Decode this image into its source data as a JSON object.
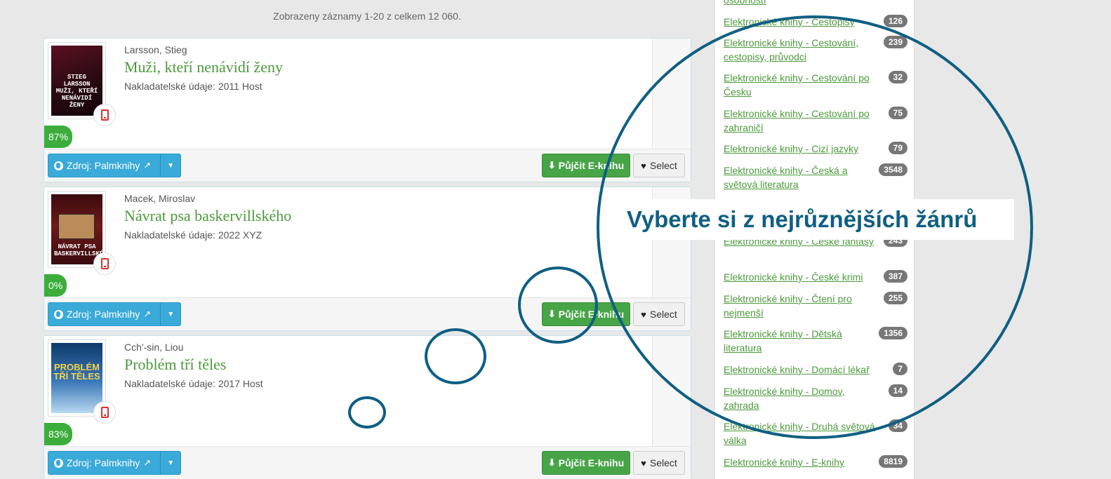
{
  "summary": "Zobrazeny záznamy 1-20 z celkem 12 060.",
  "records": [
    {
      "author": "Larsson, Stieg",
      "title": "Muži, kteří nenávidí ženy",
      "pubinfo": "Nakladatelské údaje: 2011 Host",
      "cover_text": "STIEG LARSSON MUŽI, KTEŘÍ NENÁVIDÍ ŽENY",
      "percent": "87%",
      "source_label": "Zdroj: Palmknihy",
      "borrow_label": "Půjčit E-knihu",
      "select_label": "Select"
    },
    {
      "author": "Macek, Miroslav",
      "title": "Návrat psa baskervillského",
      "pubinfo": "Nakladatelské údaje: 2022 XYZ",
      "cover_text": "NÁVRAT PSA BASKERVILLSKÉHO",
      "percent": "0%",
      "source_label": "Zdroj: Palmknihy",
      "borrow_label": "Půjčit E-knihu",
      "select_label": "Select"
    },
    {
      "author": "Cch'-sin, Liou",
      "title": "Problém tří těles",
      "pubinfo": "Nakladatelské údaje: 2017 Host",
      "cover_text": "PROBLÉM TŘÍ TĚLES",
      "percent": "83%",
      "source_label": "Zdroj: Palmknihy",
      "borrow_label": "Půjčit E-knihu",
      "select_label": "Select"
    }
  ],
  "sidebar": {
    "partial_top": "osobností",
    "genres": [
      {
        "label": "Elektronické knihy - Cestopisy",
        "count": "126"
      },
      {
        "label": "Elektronické knihy - Cestování, cestopisy, průvodci",
        "count": "239"
      },
      {
        "label": "Elektronické knihy - Cestování po Česku",
        "count": "32"
      },
      {
        "label": "Elektronické knihy - Cestování po zahraničí",
        "count": "75"
      },
      {
        "label": "Elektronické knihy - Cizí jazyky",
        "count": "79"
      },
      {
        "label": "Elektronické knihy - Česká a světová literatura",
        "count": "3548"
      },
      {
        "label": "Elektronické knihy - České fantasy",
        "count": "243"
      },
      {
        "label": "Elektronické knihy - České krimi",
        "count": "387"
      },
      {
        "label": "Elektronické knihy - Čtení pro nejmenší",
        "count": "255"
      },
      {
        "label": "Elektronické knihy - Dětská literatura",
        "count": "1356"
      },
      {
        "label": "Elektronické knihy - Domácí lékař",
        "count": "7"
      },
      {
        "label": "Elektronické knihy - Domov, zahrada",
        "count": "14"
      },
      {
        "label": "Elektronické knihy - Druhá světová válka",
        "count": "34"
      },
      {
        "label": "Elektronické knihy - E-knihy",
        "count": "8819"
      }
    ]
  },
  "overlay": {
    "headline": "Vyberte si z nejrůznějších žánrů",
    "accent_color": "#0f5f82"
  },
  "colors": {
    "title_green": "#4c9a3c",
    "source_blue": "#3aaad8",
    "borrow_green": "#47a447",
    "percent_green": "#3cad3c",
    "ebook_red": "#d9302c"
  },
  "icons": [
    "globe-icon",
    "external-link-icon",
    "caret-down-icon",
    "download-icon",
    "heart-icon",
    "tablet-icon"
  ]
}
